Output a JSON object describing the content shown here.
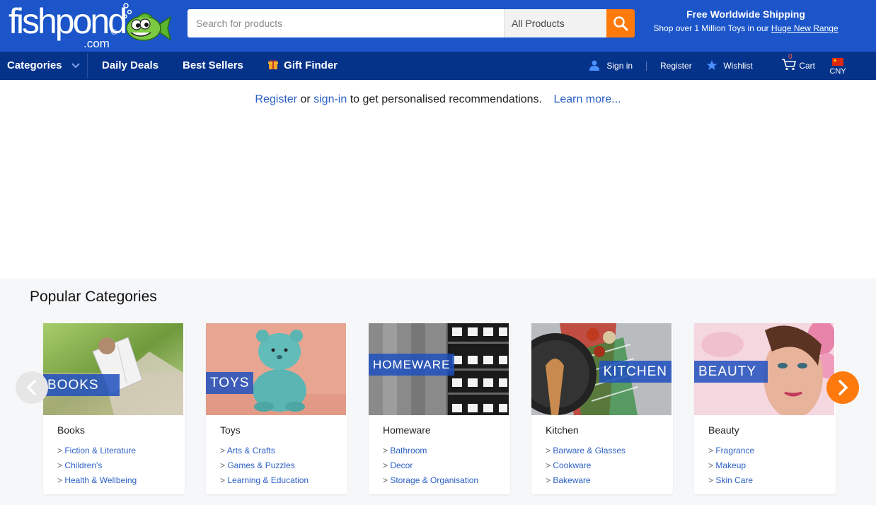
{
  "logo": {
    "main": "fishpond",
    "com": ".com",
    "reg": "®"
  },
  "search": {
    "placeholder": "Search for products",
    "category": "All Products"
  },
  "shipping": {
    "line1": "Free Worldwide Shipping",
    "line2_prefix": "Shop over 1 Million Toys in our",
    "line2_link": "Huge New Range"
  },
  "nav": {
    "categories": "Categories",
    "daily_deals": "Daily Deals",
    "best_sellers": "Best Sellers",
    "gift_finder": "Gift Finder",
    "sign_in": "Sign in",
    "register": "Register",
    "wishlist": "Wishlist",
    "cart_count": "0",
    "cart": "Cart",
    "currency": "CNY"
  },
  "reco": {
    "register": "Register",
    "or": "or",
    "signin": "sign-in",
    "rest": "to get personalised recommendations.",
    "learn": "Learn more..."
  },
  "popular": {
    "title": "Popular Categories",
    "cards": [
      {
        "badge": "BOOKS",
        "name": "Books",
        "links": [
          "Fiction & Literature",
          "Children's",
          "Health & Wellbeing"
        ]
      },
      {
        "badge": "TOYS",
        "name": "Toys",
        "links": [
          "Arts & Crafts",
          "Games & Puzzles",
          "Learning & Education"
        ]
      },
      {
        "badge": "HOMEWARE",
        "name": "Homeware",
        "links": [
          "Bathroom",
          "Decor",
          "Storage & Organisation"
        ]
      },
      {
        "badge": "KITCHEN",
        "name": "Kitchen",
        "links": [
          "Barware & Glasses",
          "Cookware",
          "Bakeware"
        ]
      },
      {
        "badge": "BEAUTY",
        "name": "Beauty",
        "links": [
          "Fragrance",
          "Makeup",
          "Skin Care"
        ]
      }
    ]
  },
  "colors": {
    "header_blue": "#1b55c9",
    "nav_blue": "#06338a",
    "accent_orange": "#ff7a0d",
    "link_blue": "#2b5fc4"
  },
  "icons": [
    "fish-mascot-icon",
    "search-icon",
    "chevron-down-icon",
    "gift-icon",
    "user-icon",
    "star-icon",
    "cart-icon",
    "china-flag-icon",
    "chevron-left-icon",
    "chevron-right-icon"
  ]
}
